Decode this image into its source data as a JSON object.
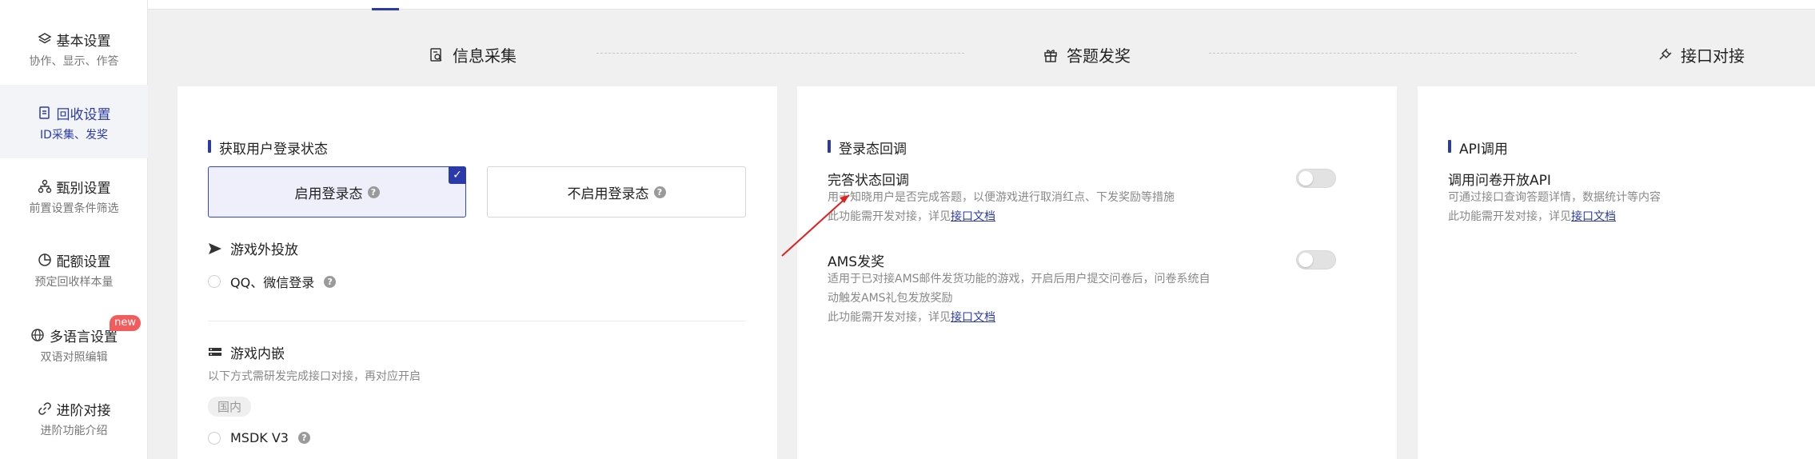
{
  "sidebar": {
    "items": [
      {
        "title": "基本设置",
        "sub": "协作、显示、作答",
        "icon": "layers-icon"
      },
      {
        "title": "回收设置",
        "sub": "ID采集、发奖",
        "icon": "document-icon"
      },
      {
        "title": "甄别设置",
        "sub": "前置设置条件筛选",
        "icon": "hierarchy-icon"
      },
      {
        "title": "配额设置",
        "sub": "预定回收样本量",
        "icon": "pie-chart-icon"
      },
      {
        "title": "多语言设置",
        "sub": "双语对照编辑",
        "icon": "globe-icon"
      },
      {
        "title": "进阶对接",
        "sub": "进阶功能介绍",
        "icon": "link-icon"
      }
    ],
    "new_badge": "new"
  },
  "steps": [
    {
      "label": "信息采集",
      "icon": "doc-search-icon"
    },
    {
      "label": "答题发奖",
      "icon": "gift-icon"
    },
    {
      "label": "接口对接",
      "icon": "plug-icon"
    }
  ],
  "panel1": {
    "section_title": "获取用户登录状态",
    "option_enabled": "启用登录态",
    "option_disabled": "不启用登录态",
    "external_title": "游戏外投放",
    "external_option": "QQ、微信登录",
    "embed_title": "游戏内嵌",
    "embed_note": "以下方式需研发完成接口对接，再对应开启",
    "tag_domestic": "国内",
    "msdk_option": "MSDK V3"
  },
  "panel2": {
    "section_title": "登录态回调",
    "item1_title": "完答状态回调",
    "item1_desc": "用于知晓用户是否完成答题，以便游戏进行取消红点、下发奖励等措施",
    "item1_link_prefix": "此功能需开发对接，详见",
    "item1_link": "接口文档",
    "item2_title": "AMS发奖",
    "item2_desc_line1": "适用于已对接AMS邮件发货功能的游戏，开启后用户提交问卷后，问卷系统自",
    "item2_desc_line2": "动触发AMS礼包发放奖励",
    "item2_link_prefix": "此功能需开发对接，详见",
    "item2_link": "接口文档"
  },
  "panel3": {
    "section_title": "API调用",
    "item_title": "调用问卷开放API",
    "item_desc": "可通过接口查询答题详情，数据统计等内容",
    "link_prefix": "此功能需开发对接，详见",
    "link": "接口文档"
  },
  "colors": {
    "accent": "#2a3aa8",
    "badge": "#f25c5c",
    "annotation_arrow": "#e0201f"
  }
}
